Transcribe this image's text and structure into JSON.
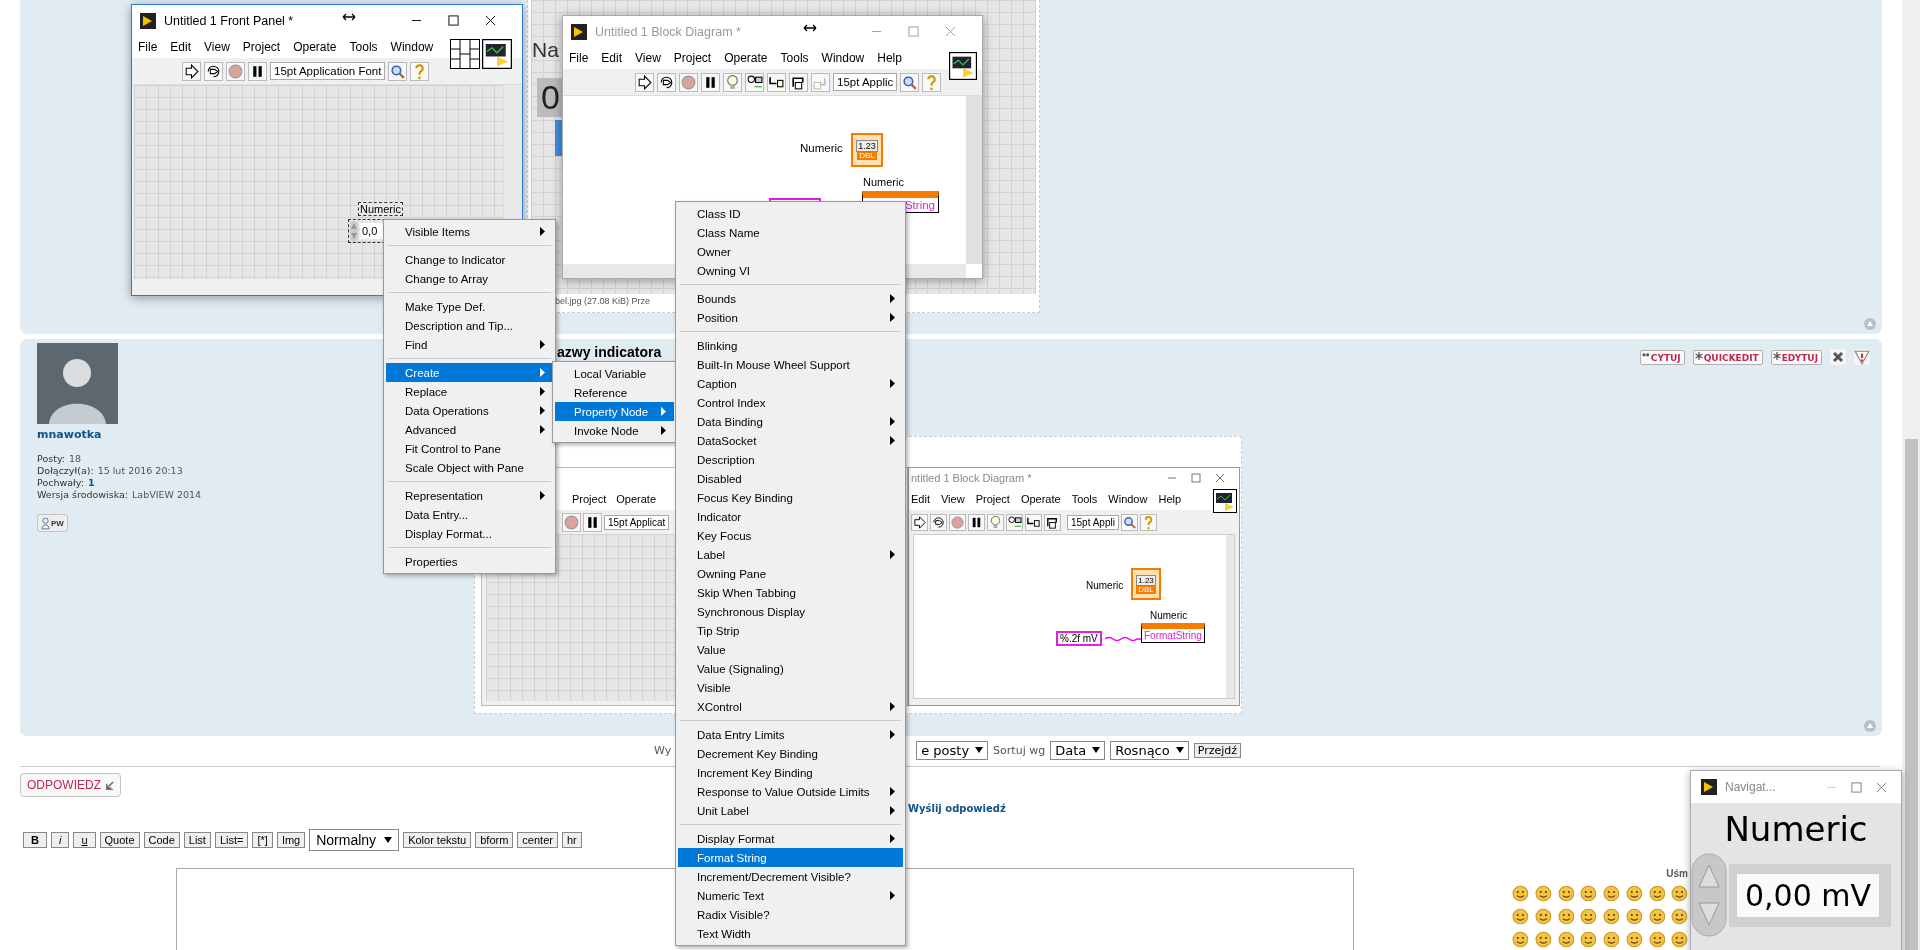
{
  "post1": {
    "image_label": "Na",
    "image_value": "0",
    "caption": "bel.jpg (27.08 KiB) Prze"
  },
  "post2": {
    "title": "azwy indicatora",
    "author": "mnawotka",
    "stats": [
      {
        "label": "Posty:",
        "value": "18",
        "emphasis": false
      },
      {
        "label": "Dołączył(a):",
        "value": "15 lut 2016 20:13",
        "emphasis": false
      },
      {
        "label": "Pochwały:",
        "value": "1",
        "emphasis": true
      },
      {
        "label": "Wersja środowiska:",
        "value": "LabVIEW 2014",
        "emphasis": false
      }
    ],
    "pm_button": "PW",
    "actions": [
      {
        "kind": "quote",
        "label": "CYTUJ"
      },
      {
        "kind": "star",
        "label": "QUICKEDIT"
      },
      {
        "kind": "star",
        "label": "EDYTUJ"
      },
      {
        "kind": "delete"
      },
      {
        "kind": "report"
      }
    ],
    "lower_front_panel": {
      "menu": [
        "Project",
        "Operate"
      ],
      "font": "15pt Applicat"
    },
    "lower_block_diagram": {
      "title": "ntitled 1 Block Diagram *",
      "menu": [
        "Edit",
        "View",
        "Project",
        "Operate",
        "Tools",
        "Window",
        "Help"
      ],
      "font": "15pt Appli",
      "terminal": {
        "label": "Numeric",
        "display": "1.23",
        "type": "DBL"
      },
      "constant": "%.2f mV",
      "property_node": {
        "label": "Numeric",
        "property": "FormatString"
      }
    }
  },
  "sort_bar": {
    "prefix": "Wy",
    "filter": "e posty",
    "sort_label": "Sortuj wg",
    "sort_by": "Data",
    "order": "Rosnąco",
    "go": "Przejdź"
  },
  "reply_button": "ODPOWIEDZ",
  "send_reply": "Wyślij odpowiedź",
  "editor_toolbar": [
    {
      "kind": "bold",
      "label": "B"
    },
    {
      "kind": "italic",
      "label": "i"
    },
    {
      "kind": "underline",
      "label": "u"
    },
    {
      "kind": "button",
      "label": "Quote"
    },
    {
      "kind": "button",
      "label": "Code"
    },
    {
      "kind": "button",
      "label": "List"
    },
    {
      "kind": "button",
      "label": "List="
    },
    {
      "kind": "button",
      "label": "[*]"
    },
    {
      "kind": "button",
      "label": "Img"
    },
    {
      "kind": "select",
      "label": "Normalny"
    },
    {
      "kind": "button",
      "label": "Kolor tekstu"
    },
    {
      "kind": "button",
      "label": "bform"
    },
    {
      "kind": "button",
      "label": "center"
    },
    {
      "kind": "button",
      "label": "hr"
    }
  ],
  "smilies_heading": "Uśm",
  "front_panel": {
    "title": "Untitled 1 Front Panel *",
    "active": true,
    "menu": [
      "File",
      "Edit",
      "View",
      "Project",
      "Operate",
      "Tools",
      "Window"
    ],
    "font": "15pt Application Font",
    "control": {
      "label": "Numeric",
      "value": "0,0"
    }
  },
  "block_diagram": {
    "title": "Untitled 1 Block Diagram *",
    "active": false,
    "menu": [
      "File",
      "Edit",
      "View",
      "Project",
      "Operate",
      "Tools",
      "Window",
      "Help"
    ],
    "font": "15pt Applic",
    "terminal": {
      "label": "Numeric",
      "display": "1.23",
      "type": "DBL"
    },
    "property_node": {
      "label": "Numeric",
      "property": "String"
    }
  },
  "context_menu": [
    [
      {
        "label": "Visible Items",
        "submenu": true,
        "selected": false
      }
    ],
    [
      {
        "label": "Change to Indicator",
        "submenu": false,
        "selected": false
      },
      {
        "label": "Change to Array",
        "submenu": false,
        "selected": false
      }
    ],
    [
      {
        "label": "Make Type Def.",
        "submenu": false,
        "selected": false
      },
      {
        "label": "Description and Tip...",
        "submenu": false,
        "selected": false
      },
      {
        "label": "Find",
        "submenu": true,
        "selected": false
      }
    ],
    [
      {
        "label": "Create",
        "submenu": true,
        "selected": true
      },
      {
        "label": "Replace",
        "submenu": true,
        "selected": false
      },
      {
        "label": "Data Operations",
        "submenu": true,
        "selected": false
      },
      {
        "label": "Advanced",
        "submenu": true,
        "selected": false
      },
      {
        "label": "Fit Control to Pane",
        "submenu": false,
        "selected": false
      },
      {
        "label": "Scale Object with Pane",
        "submenu": false,
        "selected": false
      }
    ],
    [
      {
        "label": "Representation",
        "submenu": true,
        "selected": false
      },
      {
        "label": "Data Entry...",
        "submenu": false,
        "selected": false
      },
      {
        "label": "Display Format...",
        "submenu": false,
        "selected": false
      }
    ],
    [
      {
        "label": "Properties",
        "submenu": false,
        "selected": false
      }
    ]
  ],
  "create_submenu": [
    {
      "label": "Local Variable",
      "submenu": false,
      "selected": false
    },
    {
      "label": "Reference",
      "submenu": false,
      "selected": false
    },
    {
      "label": "Property Node",
      "submenu": true,
      "selected": true
    },
    {
      "label": "Invoke Node",
      "submenu": true,
      "selected": false
    }
  ],
  "property_menu": [
    [
      {
        "label": "Class ID",
        "submenu": false,
        "selected": false
      },
      {
        "label": "Class Name",
        "submenu": false,
        "selected": false
      },
      {
        "label": "Owner",
        "submenu": false,
        "selected": false
      },
      {
        "label": "Owning VI",
        "submenu": false,
        "selected": false
      }
    ],
    [
      {
        "label": "Bounds",
        "submenu": true,
        "selected": false
      },
      {
        "label": "Position",
        "submenu": true,
        "selected": false
      }
    ],
    [
      {
        "label": "Blinking",
        "submenu": false,
        "selected": false
      },
      {
        "label": "Built-In Mouse Wheel Support",
        "submenu": false,
        "selected": false
      },
      {
        "label": "Caption",
        "submenu": true,
        "selected": false
      },
      {
        "label": "Control Index",
        "submenu": false,
        "selected": false
      },
      {
        "label": "Data Binding",
        "submenu": true,
        "selected": false
      },
      {
        "label": "DataSocket",
        "submenu": true,
        "selected": false
      },
      {
        "label": "Description",
        "submenu": false,
        "selected": false
      },
      {
        "label": "Disabled",
        "submenu": false,
        "selected": false
      },
      {
        "label": "Focus Key Binding",
        "submenu": false,
        "selected": false
      },
      {
        "label": "Indicator",
        "submenu": false,
        "selected": false
      },
      {
        "label": "Key Focus",
        "submenu": false,
        "selected": false
      },
      {
        "label": "Label",
        "submenu": true,
        "selected": false
      },
      {
        "label": "Owning Pane",
        "submenu": false,
        "selected": false
      },
      {
        "label": "Skip When Tabbing",
        "submenu": false,
        "selected": false
      },
      {
        "label": "Synchronous Display",
        "submenu": false,
        "selected": false
      },
      {
        "label": "Tip Strip",
        "submenu": false,
        "selected": false
      },
      {
        "label": "Value",
        "submenu": false,
        "selected": false
      },
      {
        "label": "Value (Signaling)",
        "submenu": false,
        "selected": false
      },
      {
        "label": "Visible",
        "submenu": false,
        "selected": false
      },
      {
        "label": "XControl",
        "submenu": true,
        "selected": false
      }
    ],
    [
      {
        "label": "Data Entry Limits",
        "submenu": true,
        "selected": false
      },
      {
        "label": "Decrement Key Binding",
        "submenu": false,
        "selected": false
      },
      {
        "label": "Increment Key Binding",
        "submenu": false,
        "selected": false
      },
      {
        "label": "Response to Value Outside Limits",
        "submenu": true,
        "selected": false
      },
      {
        "label": "Unit Label",
        "submenu": true,
        "selected": false
      }
    ],
    [
      {
        "label": "Display Format",
        "submenu": true,
        "selected": false
      },
      {
        "label": "Format String",
        "submenu": false,
        "selected": true
      },
      {
        "label": "Increment/Decrement Visible?",
        "submenu": false,
        "selected": false
      },
      {
        "label": "Numeric Text",
        "submenu": true,
        "selected": false
      },
      {
        "label": "Radix Visible?",
        "submenu": false,
        "selected": false
      },
      {
        "label": "Text Width",
        "submenu": false,
        "selected": false
      }
    ]
  ],
  "navigator": {
    "title": "Navigat...",
    "label": "Numeric",
    "value": "0,00 mV"
  }
}
